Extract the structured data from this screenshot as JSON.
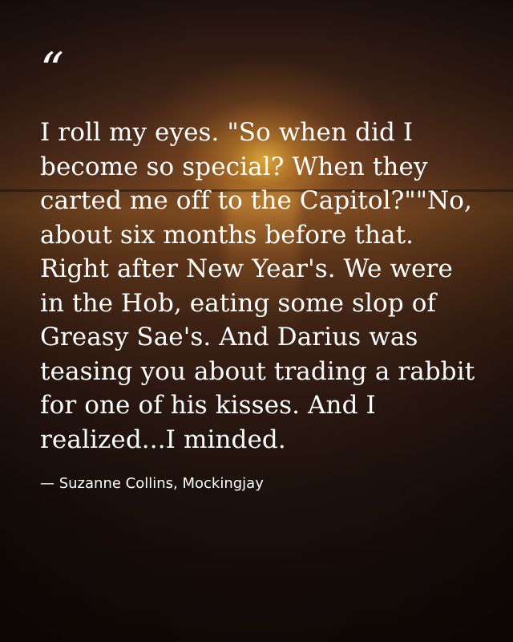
{
  "quote": {
    "mark": "“",
    "text": "I roll my eyes. \"So when did I become so special? When they carted me off to the Capitol?\"\"No, about six months before that. Right after New Year's. We were in the Hob, eating some slop of Greasy Sae's. And Darius was teasing you about trading a rabbit for one of his kisses. And I realized...I minded.",
    "attribution": "— Suzanne Collins, Mockingjay"
  },
  "colors": {
    "text": "#ffffff",
    "sky": "#5a331d",
    "sun": "#e7b03a"
  }
}
